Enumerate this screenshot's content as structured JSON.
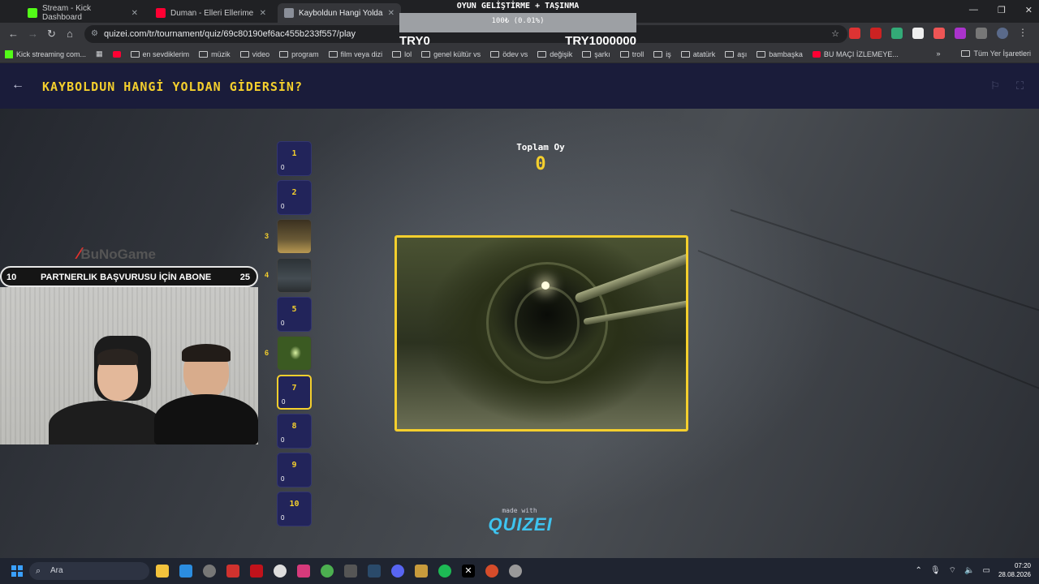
{
  "browser": {
    "tabs": [
      {
        "label": "Stream - Kick Dashboard",
        "color": "#53fc18"
      },
      {
        "label": "Duman - Elleri Ellerime - YouTube",
        "color": "#ff0033"
      },
      {
        "label": "Kayboldun Hangi Yoldan Gidersin",
        "color": "#8a8f99"
      }
    ],
    "url": "quizei.com/tr/tournament/quiz/69c80190ef6ac455b233f557/play",
    "bookmarks": [
      "Kick streaming com...",
      "en sevdiklerim",
      "müzik",
      "video",
      "program",
      "film veya dizi",
      "lol",
      "genel kültür vs",
      "ödev vs",
      "değişik",
      "şarkı",
      "troll",
      "iş",
      "atatürk",
      "aşı",
      "bambaşka",
      "BU MAÇI İZLEMEYE..."
    ],
    "all_bookmarks": "Tüm Yer İşaretleri"
  },
  "stream_overlay": {
    "title": "OYUN GELİŞTİRME + TAŞINMA",
    "progress_text": "100₺ (0.01%)",
    "progress": 0.01,
    "left_value": "TRY0",
    "right_value": "TRY1000000"
  },
  "quiz": {
    "title": "KAYBOLDUN HANGİ YOLDAN GİDERSİN?",
    "total_label": "Toplam Oy",
    "total_value": "0",
    "accent": "#f4cf2d"
  },
  "bracket": [
    {
      "num": "1",
      "votes": "0"
    },
    {
      "num": "2",
      "votes": "0"
    },
    {
      "num": "3",
      "votes": ""
    },
    {
      "num": "4",
      "votes": ""
    },
    {
      "num": "5",
      "votes": "0"
    },
    {
      "num": "6",
      "votes": ""
    },
    {
      "num": "7",
      "votes": "0"
    },
    {
      "num": "8",
      "votes": "0"
    },
    {
      "num": "9",
      "votes": "0"
    },
    {
      "num": "10",
      "votes": "0"
    }
  ],
  "footer": {
    "made_with": "made with",
    "brand": "QUIZEI"
  },
  "webcam": {
    "logo": "BuNoGame",
    "sub_min": "10",
    "sub_label": "PARTNERLIK BAŞVURUSU İÇİN ABONE",
    "sub_max": "25"
  },
  "taskbar": {
    "search_placeholder": "Ara",
    "time": "07:20",
    "date": "28.08.2026"
  }
}
